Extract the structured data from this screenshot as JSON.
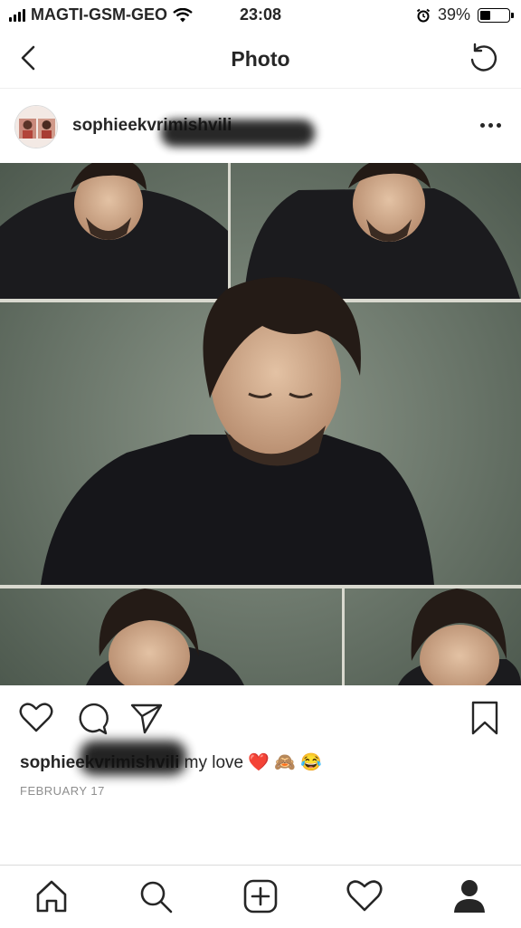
{
  "status_bar": {
    "carrier": "MAGTI-GSM-GEO",
    "time": "23:08",
    "battery": "39%",
    "battery_level": 0.39
  },
  "nav": {
    "title": "Photo",
    "back_icon": "chevron-left-icon",
    "refresh_icon": "refresh-icon"
  },
  "post": {
    "username": "sophieekvrimishvili",
    "caption_username": "sophieekvrimishvili",
    "caption_text": "my love",
    "caption_emojis": "❤️ 🙈 😂",
    "date": "FEBRUARY 17",
    "more_icon": "more-horizontal-icon"
  },
  "actions": {
    "like_icon": "heart-icon",
    "comment_icon": "comment-icon",
    "share_icon": "paper-plane-icon",
    "save_icon": "bookmark-icon"
  },
  "tab_bar": {
    "items": [
      "home-icon",
      "search-icon",
      "add-post-icon",
      "activity-heart-icon",
      "profile-icon"
    ]
  },
  "colors": {
    "text": "#262626",
    "muted": "#8e8e8e",
    "divider": "#dbdbdb",
    "heart_emoji_red": "#e0245e"
  }
}
